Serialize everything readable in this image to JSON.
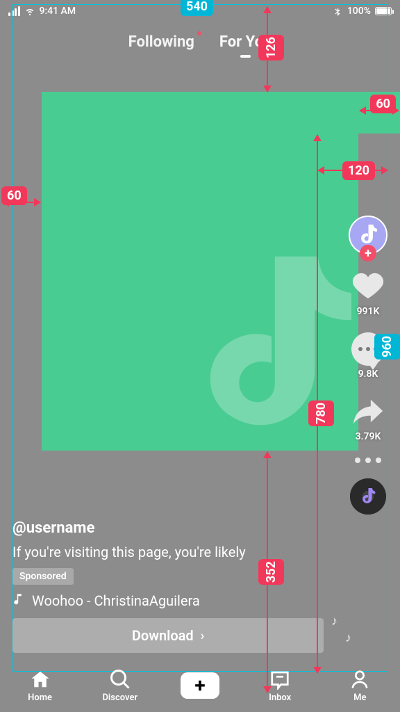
{
  "status": {
    "time": "9:41 AM",
    "battery_text": "100%"
  },
  "feed_tabs": {
    "following": "Following",
    "for_you": "For You"
  },
  "rail": {
    "likes": "991K",
    "comments": "9.8K",
    "shares": "3.79K"
  },
  "info": {
    "username": "@username",
    "caption": "If you're visiting this page, you're likely",
    "sponsored": "Sponsored",
    "music": "Woohoo - ChristinaAguilera"
  },
  "cta": {
    "label": "Download"
  },
  "bottom_nav": {
    "home": "Home",
    "discover": "Discover",
    "inbox": "Inbox",
    "me": "Me"
  },
  "dimensions": {
    "overlay_w": "540",
    "overlay_h": "960",
    "top_gap": "126",
    "left_margin": "60",
    "right_margin": "60",
    "rail_w": "120",
    "rail_h": "780",
    "info_h": "352"
  }
}
